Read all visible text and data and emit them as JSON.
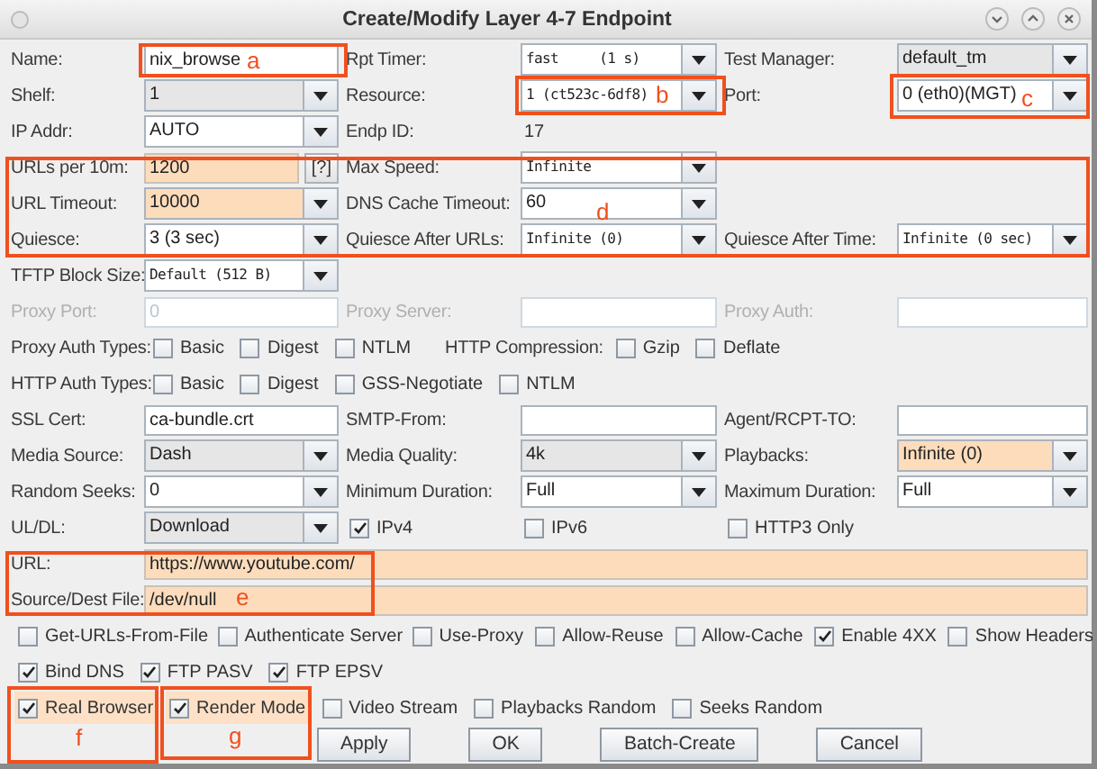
{
  "window": {
    "title": "Create/Modify Layer 4-7 Endpoint"
  },
  "rows": [
    {
      "kind": "fields",
      "disabled": false,
      "cells": [
        {
          "kind": "label",
          "text": "Name:"
        },
        {
          "kind": "text",
          "text": "nix_browse",
          "highlighted": false
        },
        {
          "kind": "label",
          "text": "Rpt Timer:"
        },
        {
          "kind": "combo",
          "text": "fast     (1 s)",
          "mono": true,
          "editable": true,
          "highlighted": false
        },
        {
          "kind": "label",
          "text": "Test Manager:"
        },
        {
          "kind": "combo",
          "text": "default_tm",
          "editable": false,
          "highlighted": false
        }
      ]
    },
    {
      "kind": "fields",
      "disabled": false,
      "cells": [
        {
          "kind": "label",
          "text": "Shelf:"
        },
        {
          "kind": "combo",
          "text": "1",
          "editable": false,
          "highlighted": false
        },
        {
          "kind": "label",
          "text": "Resource:"
        },
        {
          "kind": "combo",
          "text": "1 (ct523c-6df8)",
          "mono": true,
          "editable": true,
          "highlighted": false
        },
        {
          "kind": "label",
          "text": "Port:"
        },
        {
          "kind": "combo",
          "text": "0 (eth0)(MGT)",
          "editable": true,
          "highlighted": false
        }
      ]
    },
    {
      "kind": "fields",
      "disabled": false,
      "cells": [
        {
          "kind": "label",
          "text": "IP Addr:"
        },
        {
          "kind": "combo",
          "text": "AUTO",
          "editable": true,
          "highlighted": false
        },
        {
          "kind": "label",
          "text": "Endp ID:"
        },
        {
          "kind": "value",
          "text": "17"
        }
      ]
    },
    {
      "kind": "fields",
      "disabled": false,
      "cells": [
        {
          "kind": "label",
          "text": "URLs per 10m:"
        },
        {
          "kind": "text",
          "text": "1200",
          "highlighted": true,
          "help_button": "[?]"
        },
        {
          "kind": "label",
          "text": "Max Speed:"
        },
        {
          "kind": "combo",
          "text": "Infinite",
          "mono": true,
          "editable": true,
          "highlighted": false
        }
      ]
    },
    {
      "kind": "fields",
      "disabled": false,
      "cells": [
        {
          "kind": "label",
          "text": "URL Timeout:"
        },
        {
          "kind": "combo",
          "text": "10000",
          "editable": true,
          "highlighted": true
        },
        {
          "kind": "label",
          "text": "DNS Cache Timeout:"
        },
        {
          "kind": "combo",
          "text": "60",
          "editable": true,
          "highlighted": false
        }
      ]
    },
    {
      "kind": "fields",
      "disabled": false,
      "cells": [
        {
          "kind": "label",
          "text": "Quiesce:"
        },
        {
          "kind": "combo",
          "text": "3 (3 sec)",
          "editable": true,
          "highlighted": false
        },
        {
          "kind": "label",
          "text": "Quiesce After URLs:"
        },
        {
          "kind": "combo",
          "text": "Infinite (0)",
          "mono": true,
          "editable": true,
          "highlighted": false
        },
        {
          "kind": "label",
          "text": "Quiesce After Time:"
        },
        {
          "kind": "combo",
          "text": "Infinite (0 sec)",
          "mono": true,
          "editable": true,
          "highlighted": false
        }
      ]
    },
    {
      "kind": "fields",
      "disabled": false,
      "cells": [
        {
          "kind": "label",
          "text": "TFTP Block Size:"
        },
        {
          "kind": "combo",
          "text": "Default (512 B)",
          "mono": true,
          "editable": true,
          "highlighted": false
        }
      ]
    },
    {
      "kind": "fields",
      "disabled": true,
      "cells": [
        {
          "kind": "label",
          "text": "Proxy Port:"
        },
        {
          "kind": "text",
          "text": "0",
          "highlighted": false
        },
        {
          "kind": "label",
          "text": "Proxy Server:"
        },
        {
          "kind": "text",
          "highlighted": false
        },
        {
          "kind": "label",
          "text": "Proxy Auth:"
        },
        {
          "kind": "text",
          "highlighted": false
        }
      ]
    },
    {
      "kind": "checks",
      "disabled": false,
      "cells": [
        {
          "kind": "label",
          "text": "Proxy Auth Types:"
        },
        {
          "kind": "check",
          "text": "Basic",
          "checked": false,
          "highlighted": false
        },
        {
          "kind": "check",
          "text": "Digest",
          "checked": false,
          "highlighted": false
        },
        {
          "kind": "check",
          "text": "NTLM",
          "checked": false,
          "highlighted": false
        },
        {
          "kind": "label",
          "text": "HTTP Compression:"
        },
        {
          "kind": "check",
          "text": "Gzip",
          "checked": false,
          "highlighted": false
        },
        {
          "kind": "check",
          "text": "Deflate",
          "checked": false,
          "highlighted": false
        }
      ]
    },
    {
      "kind": "checks",
      "disabled": false,
      "cells": [
        {
          "kind": "label",
          "text": "HTTP Auth Types:"
        },
        {
          "kind": "check",
          "text": "Basic",
          "checked": false,
          "highlighted": false
        },
        {
          "kind": "check",
          "text": "Digest",
          "checked": false,
          "highlighted": false
        },
        {
          "kind": "check",
          "text": "GSS-Negotiate",
          "checked": false,
          "highlighted": false
        },
        {
          "kind": "check",
          "text": "NTLM",
          "checked": false,
          "highlighted": false
        }
      ]
    },
    {
      "kind": "fields",
      "disabled": false,
      "cells": [
        {
          "kind": "label",
          "text": "SSL Cert:"
        },
        {
          "kind": "text",
          "text": "ca-bundle.crt",
          "highlighted": false
        },
        {
          "kind": "label",
          "text": "SMTP-From:"
        },
        {
          "kind": "text",
          "highlighted": false
        },
        {
          "kind": "label",
          "text": "Agent/RCPT-TO:"
        },
        {
          "kind": "text",
          "highlighted": false
        }
      ]
    },
    {
      "kind": "fields",
      "disabled": false,
      "cells": [
        {
          "kind": "label",
          "text": "Media Source:"
        },
        {
          "kind": "combo",
          "text": "Dash",
          "editable": false,
          "highlighted": false
        },
        {
          "kind": "label",
          "text": "Media Quality:"
        },
        {
          "kind": "combo",
          "text": "4k",
          "editable": false,
          "highlighted": false
        },
        {
          "kind": "label",
          "text": "Playbacks:"
        },
        {
          "kind": "combo",
          "text": "Infinite (0)",
          "editable": true,
          "highlighted": true
        }
      ]
    },
    {
      "kind": "fields",
      "disabled": false,
      "cells": [
        {
          "kind": "label",
          "text": "Random Seeks:"
        },
        {
          "kind": "combo",
          "text": "0",
          "editable": true,
          "highlighted": false
        },
        {
          "kind": "label",
          "text": "Minimum Duration:"
        },
        {
          "kind": "combo",
          "text": "Full",
          "editable": true,
          "highlighted": false
        },
        {
          "kind": "label",
          "text": "Maximum Duration:"
        },
        {
          "kind": "combo",
          "text": "Full",
          "editable": true,
          "highlighted": false
        }
      ]
    },
    {
      "kind": "fields",
      "disabled": false,
      "cells": [
        {
          "kind": "label",
          "text": "UL/DL:"
        },
        {
          "kind": "combo",
          "text": "Download",
          "editable": false,
          "highlighted": false
        },
        {
          "kind": "check",
          "text": "IPv4",
          "checked": true,
          "highlighted": false
        },
        {
          "kind": "check",
          "text": "IPv6",
          "checked": false,
          "highlighted": false
        },
        {
          "kind": "check",
          "text": "HTTP3 Only",
          "checked": false,
          "highlighted": false
        }
      ]
    },
    {
      "kind": "fields",
      "disabled": false,
      "cells": [
        {
          "kind": "label",
          "text": "URL:"
        },
        {
          "kind": "text",
          "text": "https://www.youtube.com/",
          "highlighted": true
        }
      ]
    },
    {
      "kind": "fields",
      "disabled": false,
      "cells": [
        {
          "kind": "label",
          "text": "Source/Dest File:"
        },
        {
          "kind": "text",
          "text": "/dev/null",
          "highlighted": true
        }
      ]
    },
    {
      "kind": "checks",
      "disabled": false,
      "cells": [
        {
          "kind": "check",
          "text": "Get-URLs-From-File",
          "checked": false,
          "highlighted": false
        },
        {
          "kind": "check",
          "text": "Authenticate Server",
          "checked": false,
          "highlighted": false
        },
        {
          "kind": "check",
          "text": "Use-Proxy",
          "checked": false,
          "highlighted": false
        },
        {
          "kind": "check",
          "text": "Allow-Reuse",
          "checked": false,
          "highlighted": false
        },
        {
          "kind": "check",
          "text": "Allow-Cache",
          "checked": false,
          "highlighted": false
        },
        {
          "kind": "check",
          "text": "Enable 4XX",
          "checked": true,
          "highlighted": false
        },
        {
          "kind": "check",
          "text": "Show Headers",
          "checked": false,
          "highlighted": false
        }
      ]
    },
    {
      "kind": "checks",
      "disabled": false,
      "cells": [
        {
          "kind": "check",
          "text": "Bind DNS",
          "checked": true,
          "highlighted": false
        },
        {
          "kind": "check",
          "text": "FTP PASV",
          "checked": true,
          "highlighted": false
        },
        {
          "kind": "check",
          "text": "FTP EPSV",
          "checked": true,
          "highlighted": false
        }
      ]
    },
    {
      "kind": "checks",
      "disabled": false,
      "cells": [
        {
          "kind": "check",
          "text": "Real Browser",
          "checked": true,
          "highlighted": true
        },
        {
          "kind": "check",
          "text": "Render Mode",
          "checked": true,
          "highlighted": true
        },
        {
          "kind": "check",
          "text": "Video Stream",
          "checked": false,
          "highlighted": false
        },
        {
          "kind": "check",
          "text": "Playbacks Random",
          "checked": false,
          "highlighted": false
        },
        {
          "kind": "check",
          "text": "Seeks Random",
          "checked": false,
          "highlighted": false
        }
      ]
    }
  ],
  "buttons": [
    "Apply",
    "OK",
    "Batch-Create",
    "Cancel"
  ],
  "annotations": [
    {
      "label": "a"
    },
    {
      "label": "b"
    },
    {
      "label": "c"
    },
    {
      "label": "d"
    },
    {
      "label": "e"
    },
    {
      "label": "f"
    },
    {
      "label": "g"
    }
  ]
}
